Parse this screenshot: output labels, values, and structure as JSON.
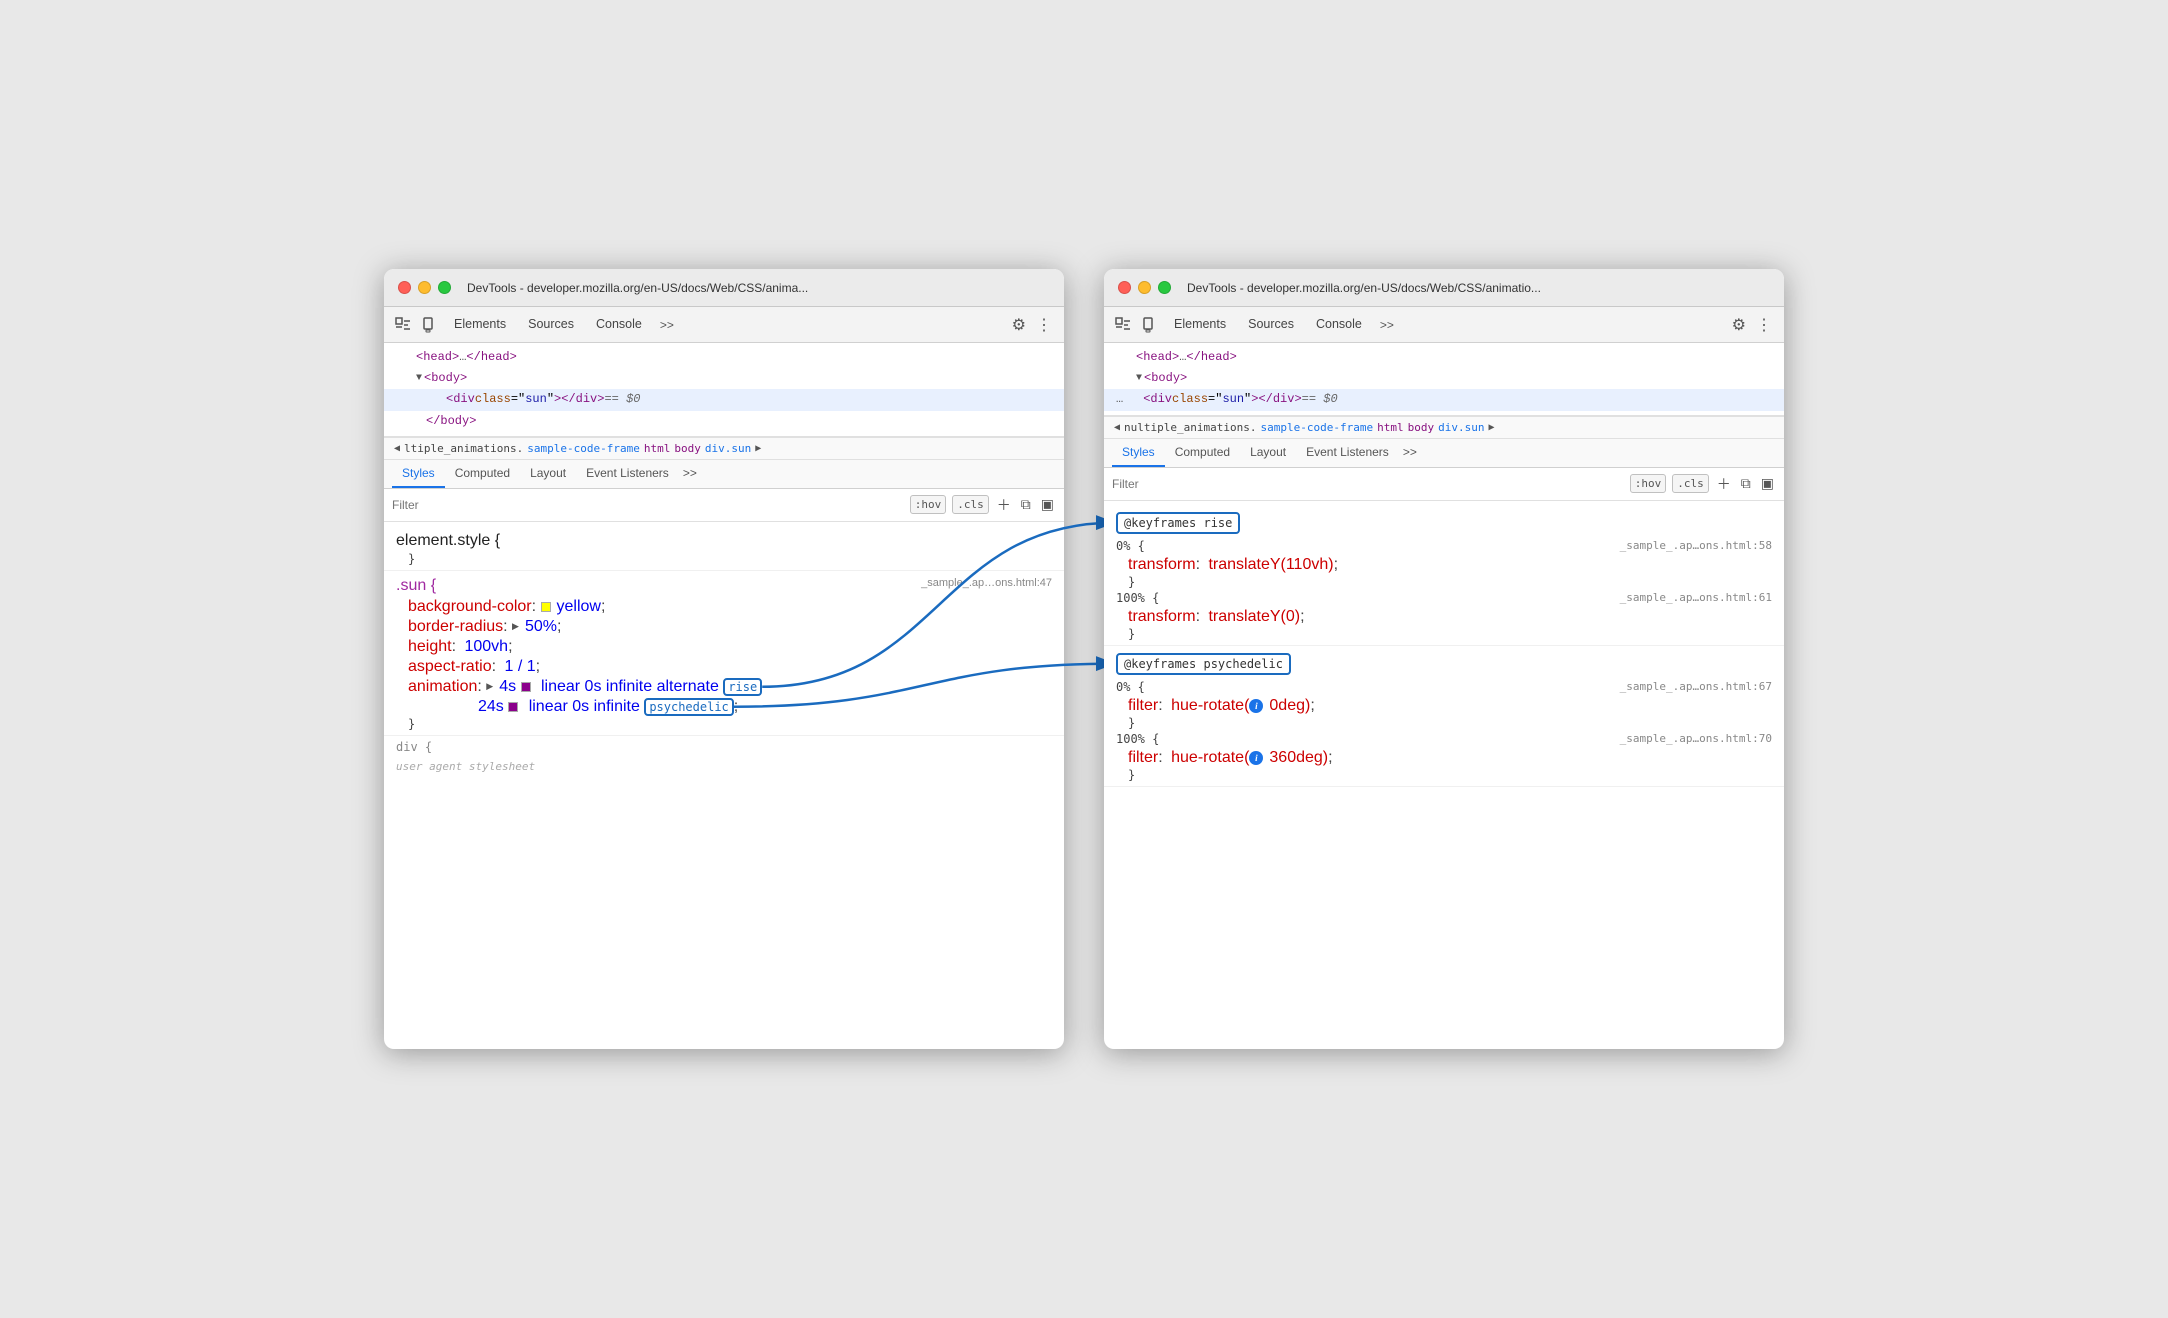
{
  "window1": {
    "title": "DevTools - developer.mozilla.org/en-US/docs/Web/CSS/anima...",
    "tabs": [
      "Elements",
      "Sources",
      "Console"
    ],
    "activeTab": "Elements",
    "subTabs": [
      "Styles",
      "Computed",
      "Layout",
      "Event Listeners"
    ],
    "activeSubTab": "Styles",
    "filterPlaceholder": "Filter",
    "filterBtns": [
      ":hov",
      ".cls"
    ],
    "htmlLines": [
      "<head> … </head>",
      "<body>",
      "<div class=\"sun\"></div>  == $0",
      "</body>"
    ],
    "breadcrumb": {
      "filename": "ltiple_animations.",
      "classname": "sample-code-frame",
      "tags": [
        "html",
        "body",
        "div.sun"
      ]
    },
    "cssRules": [
      {
        "selector": "element.style {",
        "closeBrace": "}",
        "fileRef": "",
        "props": []
      },
      {
        "selector": ".sun {",
        "closeBrace": "}",
        "fileRef": "_sample_.ap…ons.html:47",
        "props": [
          {
            "name": "background-color",
            "value": "yellow",
            "swatch": "yellow"
          },
          {
            "name": "border-radius",
            "value": "▶ 50%",
            "triangle": true
          },
          {
            "name": "height",
            "value": "100vh"
          },
          {
            "name": "aspect-ratio",
            "value": "1 / 1"
          },
          {
            "name": "animation",
            "value": "▶ 4s 🟣 linear 0s infinite alternate",
            "highlight": "rise",
            "swatch": "purple"
          },
          {
            "name": "",
            "value": "   24s 🟣 linear 0s infinite",
            "highlight": "psychedelic",
            "indent": true
          }
        ]
      }
    ],
    "moreText": "div {"
  },
  "window2": {
    "title": "DevTools - developer.mozilla.org/en-US/docs/Web/CSS/animatio...",
    "tabs": [
      "Elements",
      "Sources",
      "Console"
    ],
    "activeTab": "Elements",
    "subTabs": [
      "Styles",
      "Computed",
      "Layout",
      "Event Listeners"
    ],
    "activeSubTab": "Styles",
    "filterPlaceholder": "Filter",
    "filterBtns": [
      ":hov",
      ".cls"
    ],
    "htmlLines": [
      "<head> … </head>",
      "<body>",
      "<div class=\"sun\"></div>  == $0"
    ],
    "breadcrumb": {
      "filename": "nultiple_animations.",
      "classname": "sample-code-frame",
      "tags": [
        "html",
        "body",
        "div.sun"
      ]
    },
    "keyframeBlocks": [
      {
        "name": "@keyframes rise",
        "highlighted": true,
        "entries": [
          {
            "pct": "0% {",
            "fileRef": "_sample_.ap…ons.html:58",
            "props": [
              {
                "name": "transform",
                "value": "translateY(110vh)"
              }
            ],
            "closeBrace": "}"
          },
          {
            "pct": "100% {",
            "fileRef": "_sample_.ap…ons.html:61",
            "props": [
              {
                "name": "transform",
                "value": "translateY(0)"
              }
            ],
            "closeBrace": "}"
          }
        ]
      },
      {
        "name": "@keyframes psychedelic",
        "highlighted": true,
        "entries": [
          {
            "pct": "0% {",
            "fileRef": "_sample_.ap…ons.html:67",
            "props": [
              {
                "name": "filter",
                "value": "hue-rotate(ⓘ0deg)",
                "info": true
              }
            ],
            "closeBrace": "}"
          },
          {
            "pct": "100% {",
            "fileRef": "_sample_.ap…ons.html:70",
            "props": [
              {
                "name": "filter",
                "value": "hue-rotate(ⓘ360deg)",
                "info": true
              }
            ],
            "closeBrace": "}"
          }
        ]
      }
    ]
  },
  "arrows": {
    "rise": {
      "from": "window1-rise",
      "to": "window2-rise"
    },
    "psychedelic": {
      "from": "window1-psychedelic",
      "to": "window2-psychedelic"
    }
  }
}
